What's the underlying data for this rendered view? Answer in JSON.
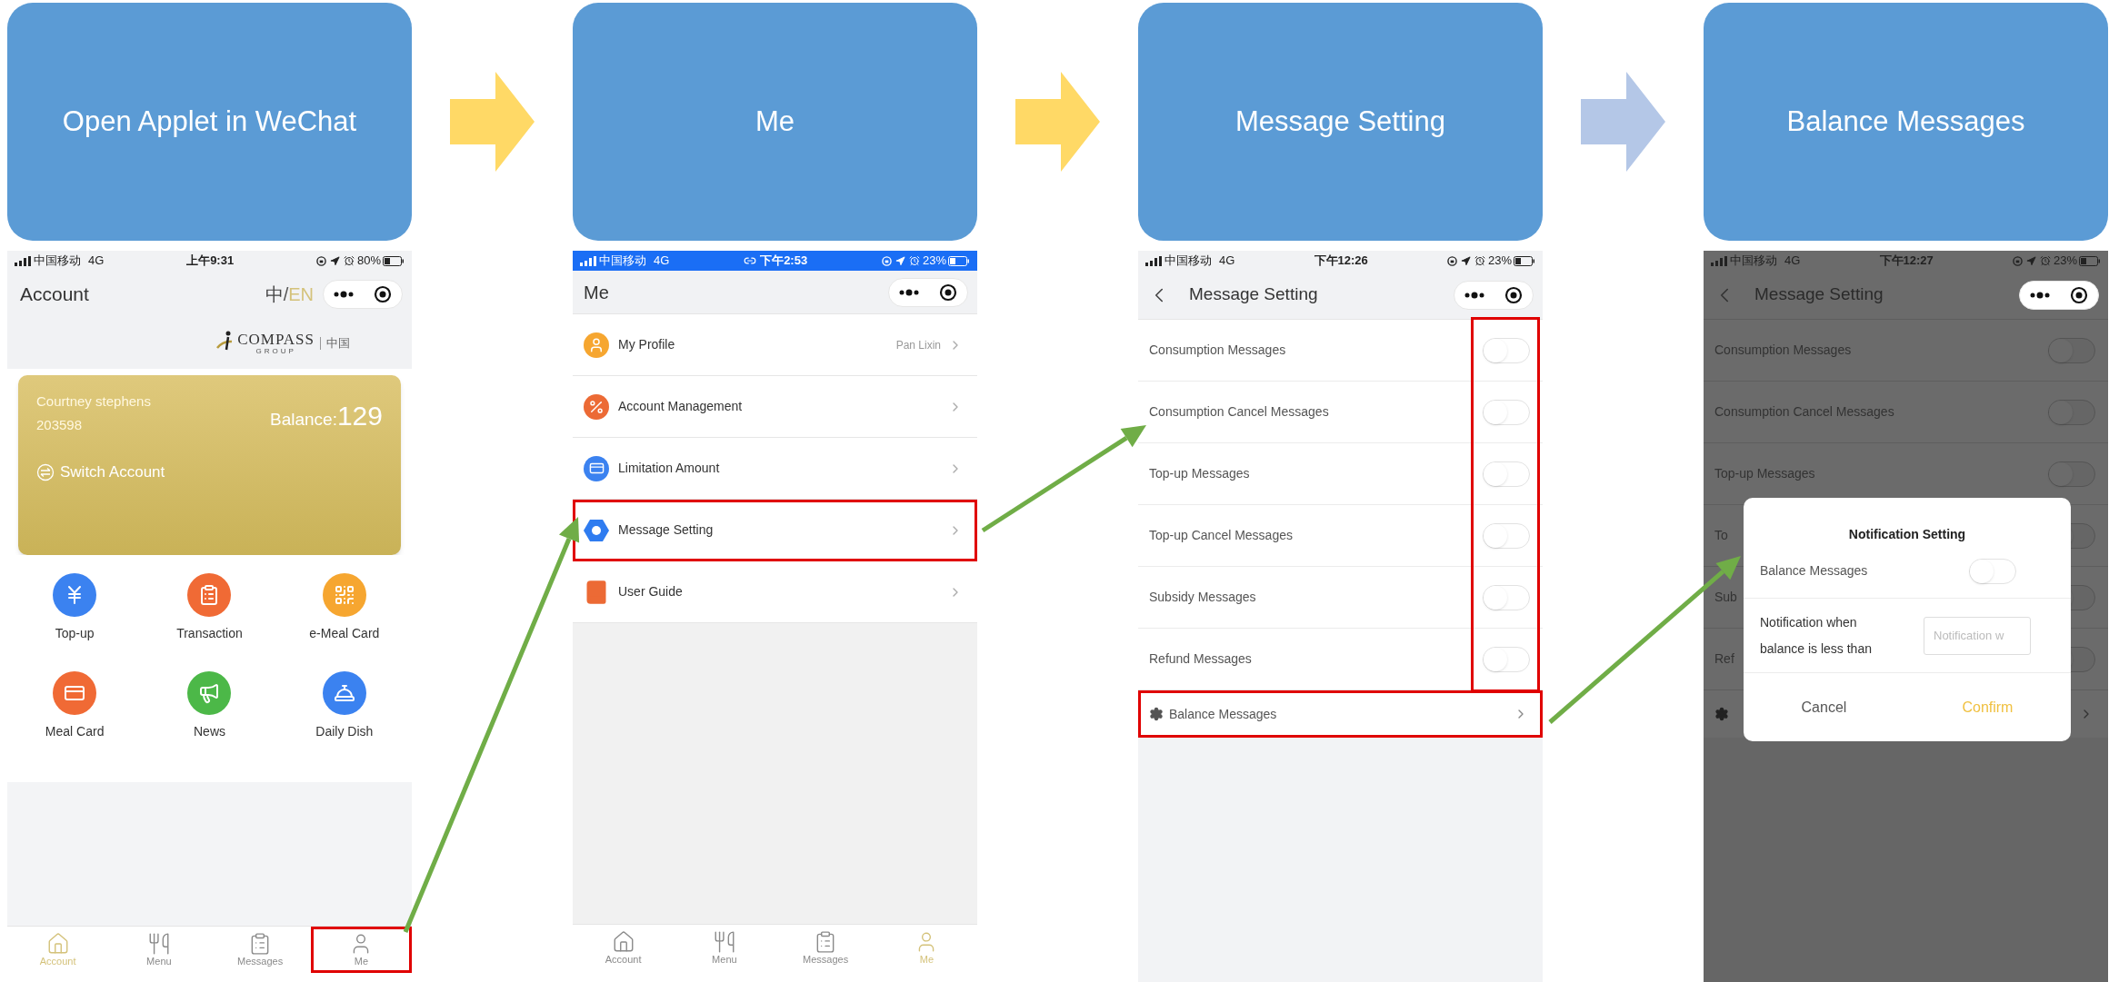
{
  "steps": [
    {
      "title": "Open Applet in WeChat"
    },
    {
      "title": "Me"
    },
    {
      "title": "Message Setting"
    },
    {
      "title": "Balance Messages"
    }
  ],
  "step_arrows": [
    {
      "color": "#ffd966"
    },
    {
      "color": "#ffd966"
    },
    {
      "color": "#b4c7e7"
    }
  ],
  "screens": [
    {
      "kind": "account",
      "status_bar": {
        "carrier": "中国移动",
        "network": "4G",
        "time": "上午9:31",
        "battery": "80%",
        "active": false
      },
      "title": "Account",
      "languages": [
        {
          "label": "中",
          "selected": false
        },
        {
          "label": "EN",
          "selected": true
        }
      ],
      "language_separator": "/",
      "logo": {
        "name": "COMPASS",
        "sub": "GROUP",
        "region": "中国"
      },
      "card": {
        "name": "Courtney stephens",
        "id": "203598",
        "balance_label": "Balance:",
        "balance": "129",
        "switch": "Switch Account"
      },
      "features": [
        {
          "label": "Top-up",
          "color": "#3b82f0"
        },
        {
          "label": "Transaction",
          "color": "#f06a35"
        },
        {
          "label": "e-Meal Card",
          "color": "#f6a630"
        },
        {
          "label": "Meal Card",
          "color": "#f06a35"
        },
        {
          "label": "News",
          "color": "#4cb848"
        },
        {
          "label": "Daily Dish",
          "color": "#3b82f0"
        }
      ],
      "tabs": [
        {
          "label": "Account",
          "selected": true,
          "highlighted": false
        },
        {
          "label": "Menu",
          "selected": false,
          "highlighted": false
        },
        {
          "label": "Messages",
          "selected": false,
          "highlighted": false
        },
        {
          "label": "Me",
          "selected": false,
          "highlighted": true
        }
      ]
    },
    {
      "kind": "me",
      "status_bar": {
        "carrier": "中国移动",
        "network": "4G",
        "time": "下午2:53",
        "battery": "23%",
        "active": true
      },
      "title": "Me",
      "items": [
        {
          "label": "My Profile",
          "value": "Pan Lixin",
          "highlighted": false
        },
        {
          "label": "Account Management",
          "highlighted": false
        },
        {
          "label": "Limitation Amount",
          "highlighted": false
        },
        {
          "label": "Message Setting",
          "highlighted": true
        },
        {
          "label": "User Guide",
          "highlighted": false
        }
      ],
      "tabs": [
        {
          "label": "Account",
          "selected": false,
          "highlighted": false
        },
        {
          "label": "Menu",
          "selected": false,
          "highlighted": false
        },
        {
          "label": "Messages",
          "selected": false,
          "highlighted": false
        },
        {
          "label": "Me",
          "selected": true,
          "highlighted": false
        }
      ]
    },
    {
      "kind": "message_setting",
      "status_bar": {
        "carrier": "中国移动",
        "network": "4G",
        "time": "下午12:26",
        "battery": "23%",
        "active": false
      },
      "title": "Message Setting",
      "toggles_highlighted": true,
      "toggles": [
        {
          "label": "Consumption Messages",
          "on": false
        },
        {
          "label": "Consumption Cancel Messages",
          "on": false
        },
        {
          "label": "Top-up Messages",
          "on": false
        },
        {
          "label": "Top-up Cancel Messages",
          "on": false
        },
        {
          "label": "Subsidy Messages",
          "on": false
        },
        {
          "label": "Refund Messages",
          "on": false
        }
      ],
      "link": {
        "label": "Balance Messages",
        "highlighted": true
      }
    },
    {
      "kind": "message_setting",
      "status_bar": {
        "carrier": "中国移动",
        "network": "4G",
        "time": "下午12:27",
        "battery": "23%",
        "active": false
      },
      "title": "Message Setting",
      "toggles_highlighted": false,
      "toggles": [
        {
          "label": "Consumption Messages",
          "on": false
        },
        {
          "label": "Consumption Cancel Messages",
          "on": false
        },
        {
          "label": "Top-up Messages",
          "on": false
        },
        {
          "label": "To",
          "on": false
        },
        {
          "label": "Sub",
          "on": false
        },
        {
          "label": "Ref",
          "on": false
        }
      ],
      "link": {
        "highlighted": false
      },
      "dialog": {
        "title": "Notification Setting",
        "toggle": {
          "label": "Balance Messages",
          "on": false
        },
        "threshold_label": "Notification when balance is less than",
        "threshold_placeholder": "Notification w",
        "cancel": "Cancel",
        "confirm": "Confirm"
      }
    }
  ]
}
